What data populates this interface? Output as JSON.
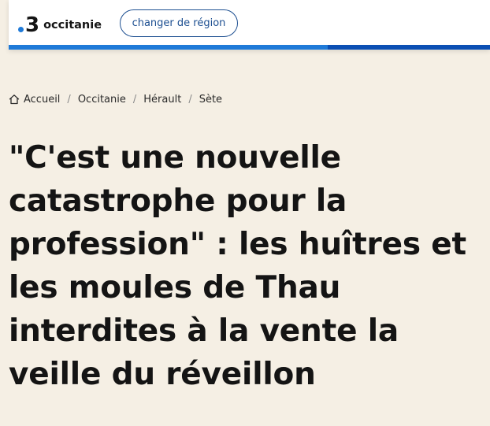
{
  "header": {
    "logo_number": "3",
    "logo_region": "occitanie",
    "change_region_label": "changer de région",
    "colors": {
      "accent_light": "#1f7ad8",
      "accent_dark": "#0b4fb4",
      "button_border": "#1d4f91"
    }
  },
  "breadcrumb": {
    "home_icon": "home-icon",
    "items": [
      "Accueil",
      "Occitanie",
      "Hérault",
      "Sète"
    ],
    "separator": "/"
  },
  "article": {
    "title": "\"C'est une nouvelle catastrophe pour la profession\" : les huîtres et les moules de Thau interdites à la vente la veille du réveillon"
  },
  "page": {
    "background": "#f5efe4"
  }
}
